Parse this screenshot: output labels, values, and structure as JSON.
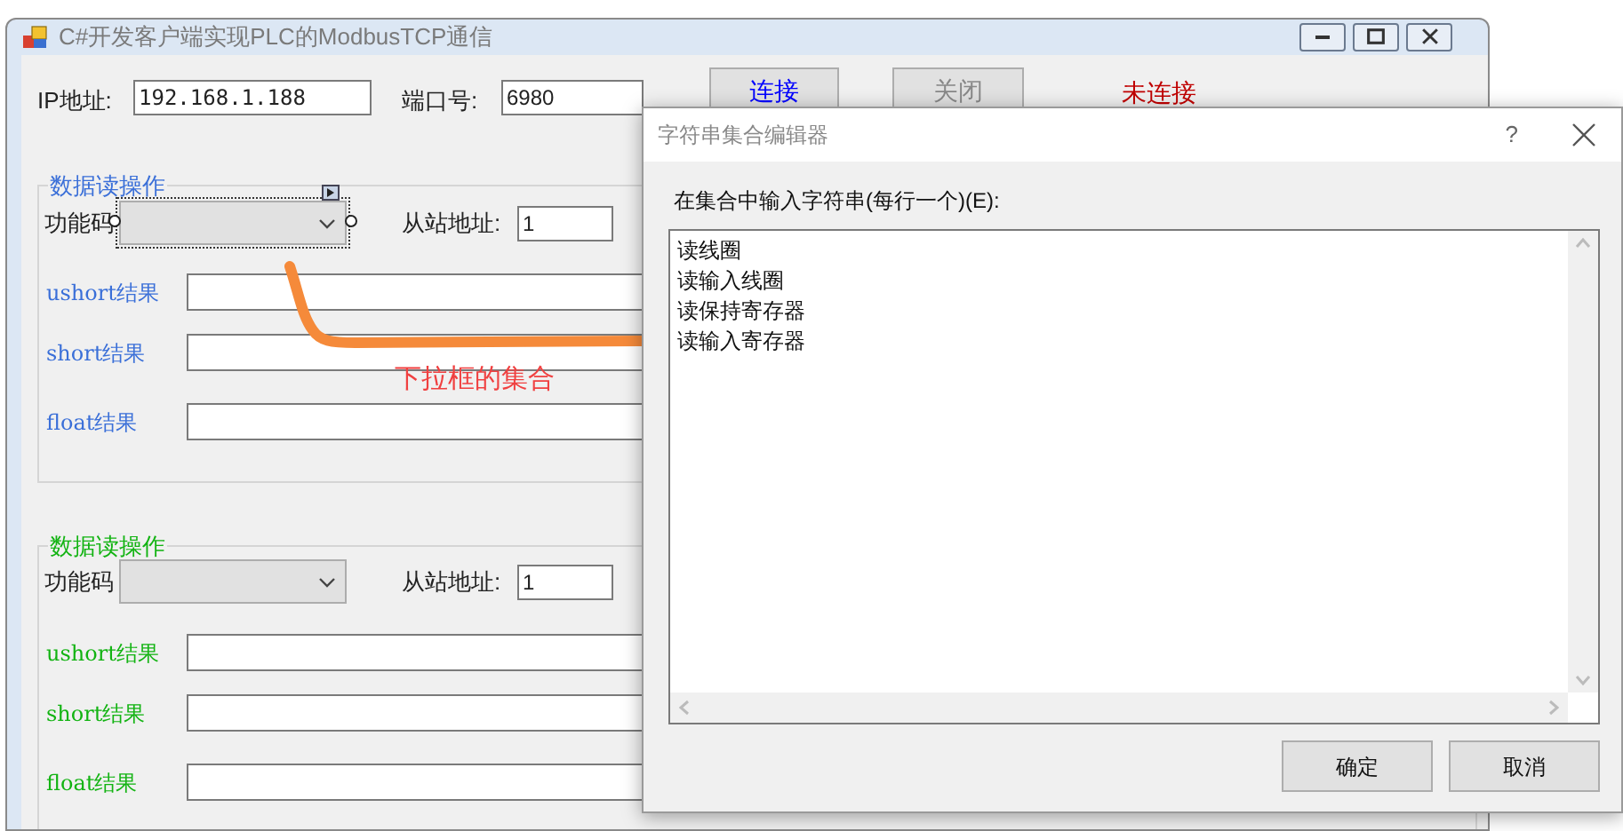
{
  "window": {
    "title": "C#开发客户端实现PLC的ModbusTCP通信"
  },
  "connection": {
    "ip_label": "IP地址:",
    "ip_value": "192.168.1.188",
    "port_label": "端口号:",
    "port_value": "6980",
    "connect_button": "连接",
    "close_button": "关闭",
    "status": "未连接"
  },
  "groups": [
    {
      "title": "数据读操作",
      "color": "#3a6fd8",
      "function_label": "功能码",
      "design_selected": true,
      "slave_label": "从站地址:",
      "slave_value": "1",
      "results": [
        {
          "label": "ushort结果"
        },
        {
          "label": "short结果"
        },
        {
          "label": "float结果"
        }
      ]
    },
    {
      "title": "数据读操作",
      "color": "#12b312",
      "function_label": "功能码",
      "design_selected": false,
      "slave_label": "从站地址:",
      "slave_value": "1",
      "results": [
        {
          "label": "ushort结果"
        },
        {
          "label": "short结果"
        },
        {
          "label": "float结果"
        }
      ]
    }
  ],
  "annotation": {
    "text": "下拉框的集合"
  },
  "dialog": {
    "title": "字符串集合编辑器",
    "help": "?",
    "prompt": "在集合中输入字符串(每行一个)(E):",
    "lines": [
      "读线圈",
      "读输入线圈",
      "读保持寄存器",
      "读输入寄存器"
    ],
    "buttons": [
      "确定",
      "取消"
    ]
  }
}
